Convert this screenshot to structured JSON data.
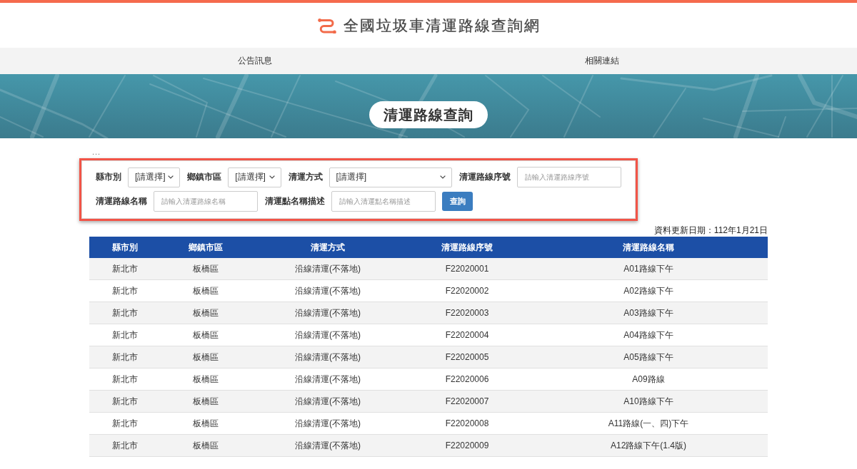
{
  "header": {
    "title": "全國垃圾車清運路線查詢網"
  },
  "nav": [
    {
      "label": "公告訊息"
    },
    {
      "label": "相關連結"
    }
  ],
  "banner": {
    "title": "清運路線查詢"
  },
  "breadcrumb": "...",
  "filter_rows": [
    [
      {
        "kind": "select",
        "label": "縣市別",
        "value": "[請選擇]"
      },
      {
        "kind": "select",
        "label": "鄉鎮市區",
        "value": "[請選擇]"
      },
      {
        "kind": "select",
        "label": "清運方式",
        "value": "[請選擇]"
      },
      {
        "kind": "input",
        "label": "清運路線序號",
        "placeholder": "請輸入清運路線序號"
      }
    ],
    [
      {
        "kind": "input",
        "label": "清運路線名稱",
        "placeholder": "請輸入清運路線名稱"
      },
      {
        "kind": "input",
        "label": "清運點名稱描述",
        "placeholder": "請輸入清運點名稱描述"
      },
      {
        "kind": "button",
        "label": "查詢"
      }
    ]
  ],
  "update_note": "資料更新日期：112年1月21日",
  "table": {
    "columns": [
      "縣市別",
      "鄉鎮市區",
      "清運方式",
      "清運路線序號",
      "清運路線名稱"
    ],
    "rows": [
      [
        "新北市",
        "板橋區",
        "沿線清運(不落地)",
        "F22020001",
        "A01路線下午"
      ],
      [
        "新北市",
        "板橋區",
        "沿線清運(不落地)",
        "F22020002",
        "A02路線下午"
      ],
      [
        "新北市",
        "板橋區",
        "沿線清運(不落地)",
        "F22020003",
        "A03路線下午"
      ],
      [
        "新北市",
        "板橋區",
        "沿線清運(不落地)",
        "F22020004",
        "A04路線下午"
      ],
      [
        "新北市",
        "板橋區",
        "沿線清運(不落地)",
        "F22020005",
        "A05路線下午"
      ],
      [
        "新北市",
        "板橋區",
        "沿線清運(不落地)",
        "F22020006",
        "A09路線"
      ],
      [
        "新北市",
        "板橋區",
        "沿線清運(不落地)",
        "F22020007",
        "A10路線下午"
      ],
      [
        "新北市",
        "板橋區",
        "沿線清運(不落地)",
        "F22020008",
        "A11路線(一、四)下午"
      ],
      [
        "新北市",
        "板橋區",
        "沿線清運(不落地)",
        "F22020009",
        "A12路線下午(1.4版)"
      ]
    ]
  }
}
